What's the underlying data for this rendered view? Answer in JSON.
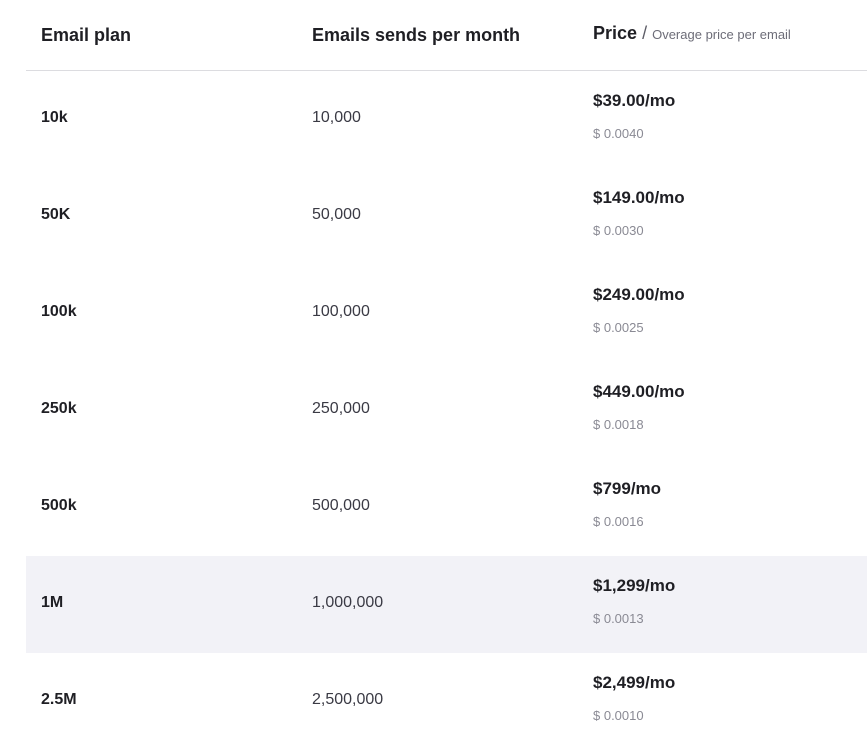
{
  "header": {
    "plan": "Email plan",
    "sends": "Emails sends per month",
    "price": "Price",
    "slash": "/",
    "overage": "Overage price per email"
  },
  "rows": [
    {
      "plan": "10k",
      "sends": "10,000",
      "price": "$39.00/mo",
      "overage": "$ 0.0040"
    },
    {
      "plan": "50K",
      "sends": "50,000",
      "price": "$149.00/mo",
      "overage": "$ 0.0030"
    },
    {
      "plan": "100k",
      "sends": "100,000",
      "price": "$249.00/mo",
      "overage": "$ 0.0025"
    },
    {
      "plan": "250k",
      "sends": "250,000",
      "price": "$449.00/mo",
      "overage": "$ 0.0018"
    },
    {
      "plan": "500k",
      "sends": "500,000",
      "price": "$799/mo",
      "overage": "$ 0.0016"
    },
    {
      "plan": "1M",
      "sends": "1,000,000",
      "price": "$1,299/mo",
      "overage": "$ 0.0013"
    },
    {
      "plan": "2.5M",
      "sends": "2,500,000",
      "price": "$2,499/mo",
      "overage": "$ 0.0010"
    }
  ],
  "colors": {
    "highlight_row_bg": "#f2f2f7",
    "text_primary": "#1f1f24",
    "text_muted": "#8a8a94",
    "divider": "#dcdce0"
  }
}
